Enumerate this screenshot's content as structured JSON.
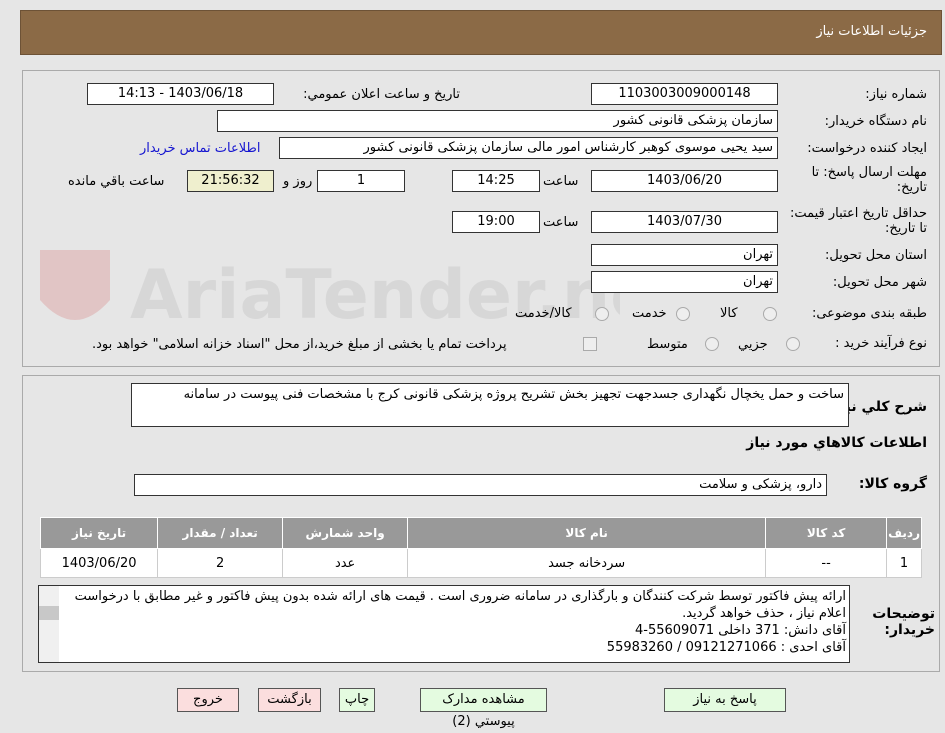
{
  "header": {
    "title": "جزئيات اطلاعات نياز"
  },
  "watermark": {
    "text": "AriaTender.net"
  },
  "fields": {
    "need_number_label": "شماره نياز:",
    "need_number": "1103003009000148",
    "announce_label": "تاريخ و ساعت اعلان عمومي:",
    "announce_value": "1403/06/18 - 14:13",
    "buyer_org_label": "نام دستگاه خريدار:",
    "buyer_org": "سازمان پزشکی قانونی کشور",
    "creator_label": "ايجاد کننده درخواست:",
    "creator": "سید یحیی موسوی کوهبر کارشناس امور مالی سازمان پزشکی قانونی کشور",
    "contact_link": "اطلاعات تماس خريدار",
    "deadline_label": "مهلت ارسال پاسخ: تا تاريخ:",
    "deadline_date": "1403/06/20",
    "time_label": "ساعت",
    "deadline_time": "14:25",
    "days": "1",
    "days_label": "روز و",
    "remaining": "21:56:32",
    "remaining_label": "ساعت باقي مانده",
    "validity_label": "حداقل تاريخ اعتبار قيمت: تا تاريخ:",
    "validity_date": "1403/07/30",
    "validity_time": "19:00",
    "province_label": "استان محل تحويل:",
    "province": "تهران",
    "city_label": "شهر محل تحويل:",
    "city": "تهران",
    "category_label": "طبقه بندی موضوعی:",
    "category_options": [
      "کالا",
      "خدمت",
      "کالا/خدمت"
    ],
    "process_label": "نوع فرآيند خريد :",
    "process_options": [
      "جزيي",
      "متوسط"
    ],
    "payment_note": "پرداخت تمام يا بخشی از مبلغ خريد،از محل \"اسناد خزانه اسلامی\" خواهد بود."
  },
  "summary": {
    "label": "شرح كلي نياز:",
    "text": "ساخت و حمل یخچال نگهداری جسدجهت تجهیز بخش تشریح پروژه پزشکی قانونی کرج با  مشخصات فنی پیوست در سامانه"
  },
  "goods": {
    "title": "اطلاعات كالاهاي مورد نياز",
    "group_label": "گروه كالا:",
    "group": "دارو، پزشکی و سلامت",
    "columns": [
      "رديف",
      "کد کالا",
      "نام کالا",
      "واحد شمارش",
      "تعداد / مقدار",
      "تاريخ نياز"
    ],
    "rows": [
      [
        "1",
        "--",
        "سردخانه جسد",
        "عدد",
        "2",
        "1403/06/20"
      ]
    ]
  },
  "notes": {
    "label": "توضيحات خريدار:",
    "lines": [
      "ارائه پیش فاکتور  توسط شرکت کنندگان و بارگذاری در سامانه ضروری است . قیمت های ارائه شده بدون پیش فاکتور  و غیر مطابق با درخواست اعلام نیاز  ، حذف خواهد گردید.",
      "آقای دانش:   371   داخلی        55609071-4",
      "آقای احدی :   09121271066  /  55983260"
    ]
  },
  "buttons": {
    "reply": "پاسخ به نياز",
    "attachments": "مشاهده مدارک پيوستي (2)",
    "print": "چاپ",
    "back": "بازگشت",
    "exit": "خروج"
  }
}
